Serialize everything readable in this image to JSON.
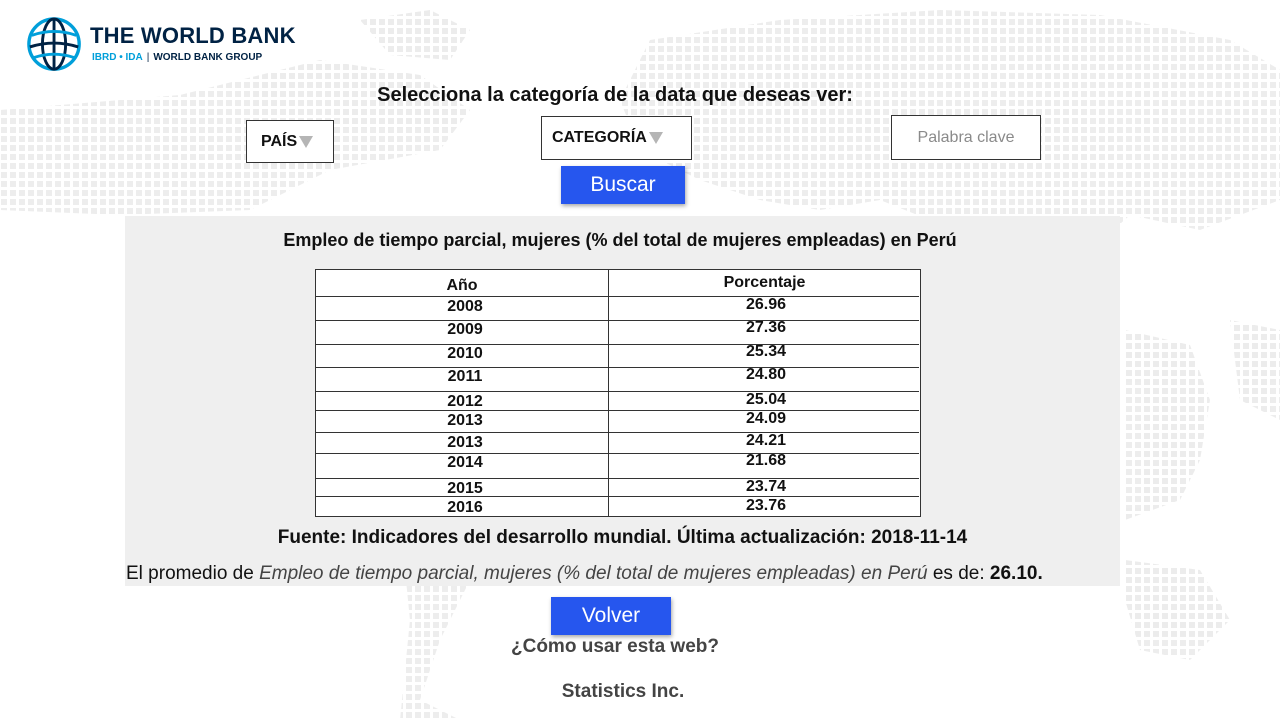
{
  "brand": {
    "title": "THE WORLD BANK",
    "sub_a": "IBRD • IDA",
    "sub_sep": "|",
    "sub_b": "WORLD BANK GROUP",
    "color_primary": "#002244",
    "color_accent": "#009fda"
  },
  "prompt": "Selecciona la categoría de la data que deseas ver:",
  "filters": {
    "country_label": "PAÍS",
    "category_label": "CATEGORÍA",
    "keyword_placeholder": "Palabra clave",
    "arrow_icon": "triangle-down-icon"
  },
  "buttons": {
    "search": "Buscar",
    "back": "Volver",
    "color": "#2656ee"
  },
  "result": {
    "title": "Empleo de tiempo parcial, mujeres (% del total de mujeres empleadas) en Perú",
    "columns": [
      "Año",
      "Porcentaje"
    ],
    "rows": [
      {
        "year": "2008",
        "value": "26.96"
      },
      {
        "year": "2009",
        "value": "27.36"
      },
      {
        "year": "2010",
        "value": "25.34"
      },
      {
        "year": "2011",
        "value": "24.80"
      },
      {
        "year": "2012",
        "value": "25.04"
      },
      {
        "year": "2013",
        "value": "24.09"
      },
      {
        "year": "2013",
        "value": "24.21"
      },
      {
        "year": "2014",
        "value": "21.68"
      },
      {
        "year": "2015",
        "value": "23.74"
      },
      {
        "year": "2016",
        "value": "23.76"
      }
    ],
    "source": "Fuente: Indicadores del desarrollo mundial. Última actualización: 2018-11-14",
    "average_prefix": "El promedio de",
    "average_indicator": "Empleo de tiempo parcial, mujeres (% del total de mujeres empleadas) en Perú",
    "average_mid": "es de:",
    "average_value": "26.10."
  },
  "help_link": "¿Cómo usar esta web?",
  "footer": "Statistics Inc."
}
